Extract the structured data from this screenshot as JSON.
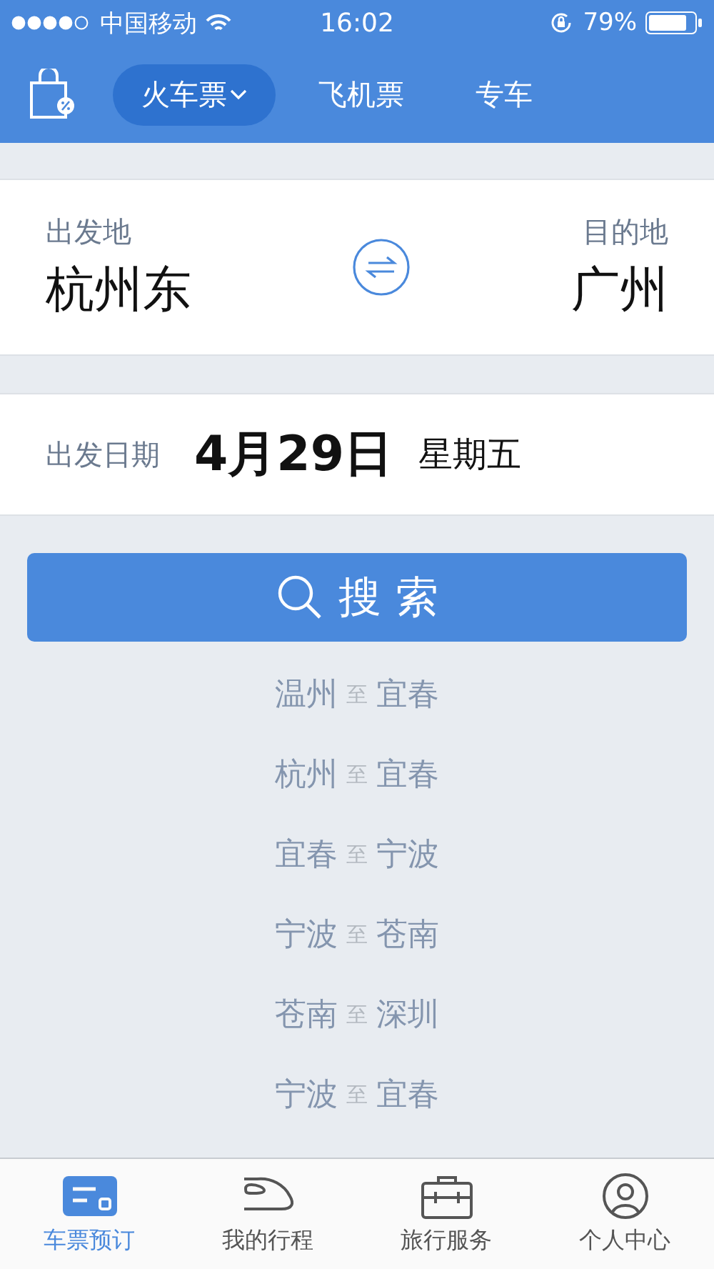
{
  "status_bar": {
    "carrier": "中国移动",
    "time": "16:02",
    "battery": "79%"
  },
  "header": {
    "tabs": [
      {
        "label": "火车票",
        "selected": true
      },
      {
        "label": "飞机票",
        "selected": false
      },
      {
        "label": "专车",
        "selected": false
      }
    ]
  },
  "route": {
    "from_label": "出发地",
    "from": "杭州东",
    "to_label": "目的地",
    "to": "广州"
  },
  "date": {
    "label": "出发日期",
    "value": "4月29日",
    "weekday": "星期五"
  },
  "search_button": "搜 索",
  "history": [
    {
      "from": "温州",
      "sep": "至",
      "to": "宜春"
    },
    {
      "from": "杭州",
      "sep": "至",
      "to": "宜春"
    },
    {
      "from": "宜春",
      "sep": "至",
      "to": "宁波"
    },
    {
      "from": "宁波",
      "sep": "至",
      "to": "苍南"
    },
    {
      "from": "苍南",
      "sep": "至",
      "to": "深圳"
    },
    {
      "from": "宁波",
      "sep": "至",
      "to": "宜春"
    }
  ],
  "tab_bar": [
    {
      "kind": "ticket",
      "label": "车票预订",
      "selected": true
    },
    {
      "kind": "train",
      "label": "我的行程",
      "selected": false
    },
    {
      "kind": "suitcase",
      "label": "旅行服务",
      "selected": false
    },
    {
      "kind": "person",
      "label": "个人中心",
      "selected": false
    }
  ]
}
